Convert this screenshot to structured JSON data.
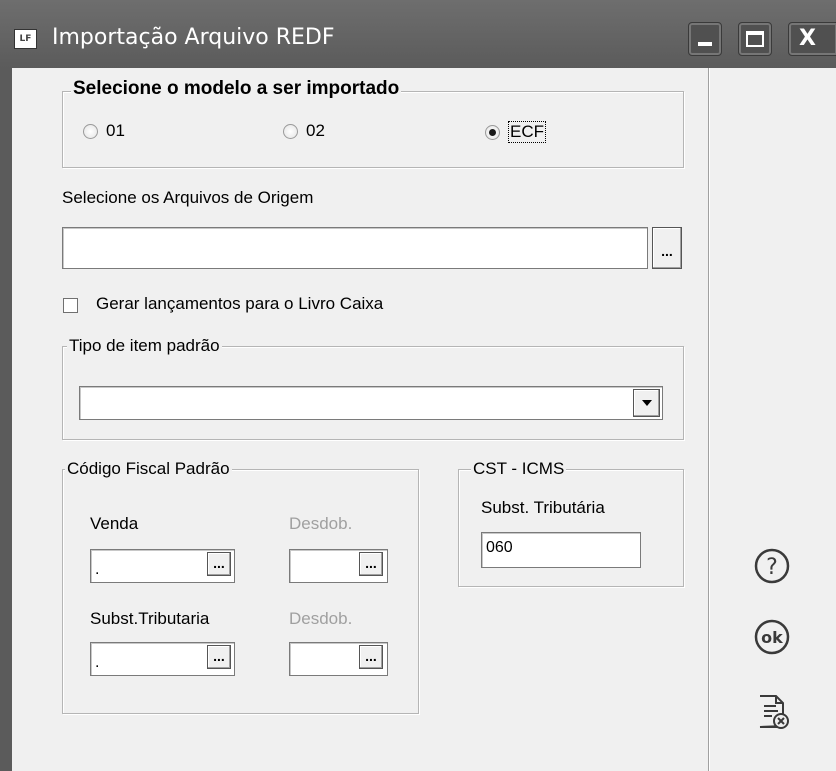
{
  "window": {
    "app_icon_text": "LF",
    "title": "Importação Arquivo REDF"
  },
  "modelo": {
    "legend": "Selecione o modelo a ser importado",
    "options": [
      {
        "label": "01",
        "checked": false
      },
      {
        "label": "02",
        "checked": false
      },
      {
        "label": "ECF",
        "checked": true
      }
    ]
  },
  "arquivos": {
    "label": "Selecione os Arquivos de Origem",
    "value": "",
    "browse_label": "..."
  },
  "livro_caixa": {
    "label": "Gerar lançamentos para o Livro Caixa",
    "checked": false
  },
  "tipo_item": {
    "legend": "Tipo de item padrão",
    "value": ""
  },
  "codigo_fiscal": {
    "legend": "Código Fiscal Padrão",
    "venda_label": "Venda",
    "venda_value": ".",
    "desdob_label_1": "Desdob.",
    "desdob_value_1": "",
    "subst_label": "Subst.Tributaria",
    "subst_value": ".",
    "desdob_label_2": "Desdob.",
    "desdob_value_2": "",
    "browse_label": "..."
  },
  "cst_icms": {
    "legend": "CST - ICMS",
    "label": "Subst. Tributária",
    "value": "060"
  },
  "side_buttons": {
    "help": "help-icon",
    "ok": "ok",
    "cancel": "cancel-document-icon"
  },
  "colors": {
    "titlebar": "#5b5b5b",
    "background": "#f0f0f0",
    "disabled_text": "#a0a0a0"
  }
}
